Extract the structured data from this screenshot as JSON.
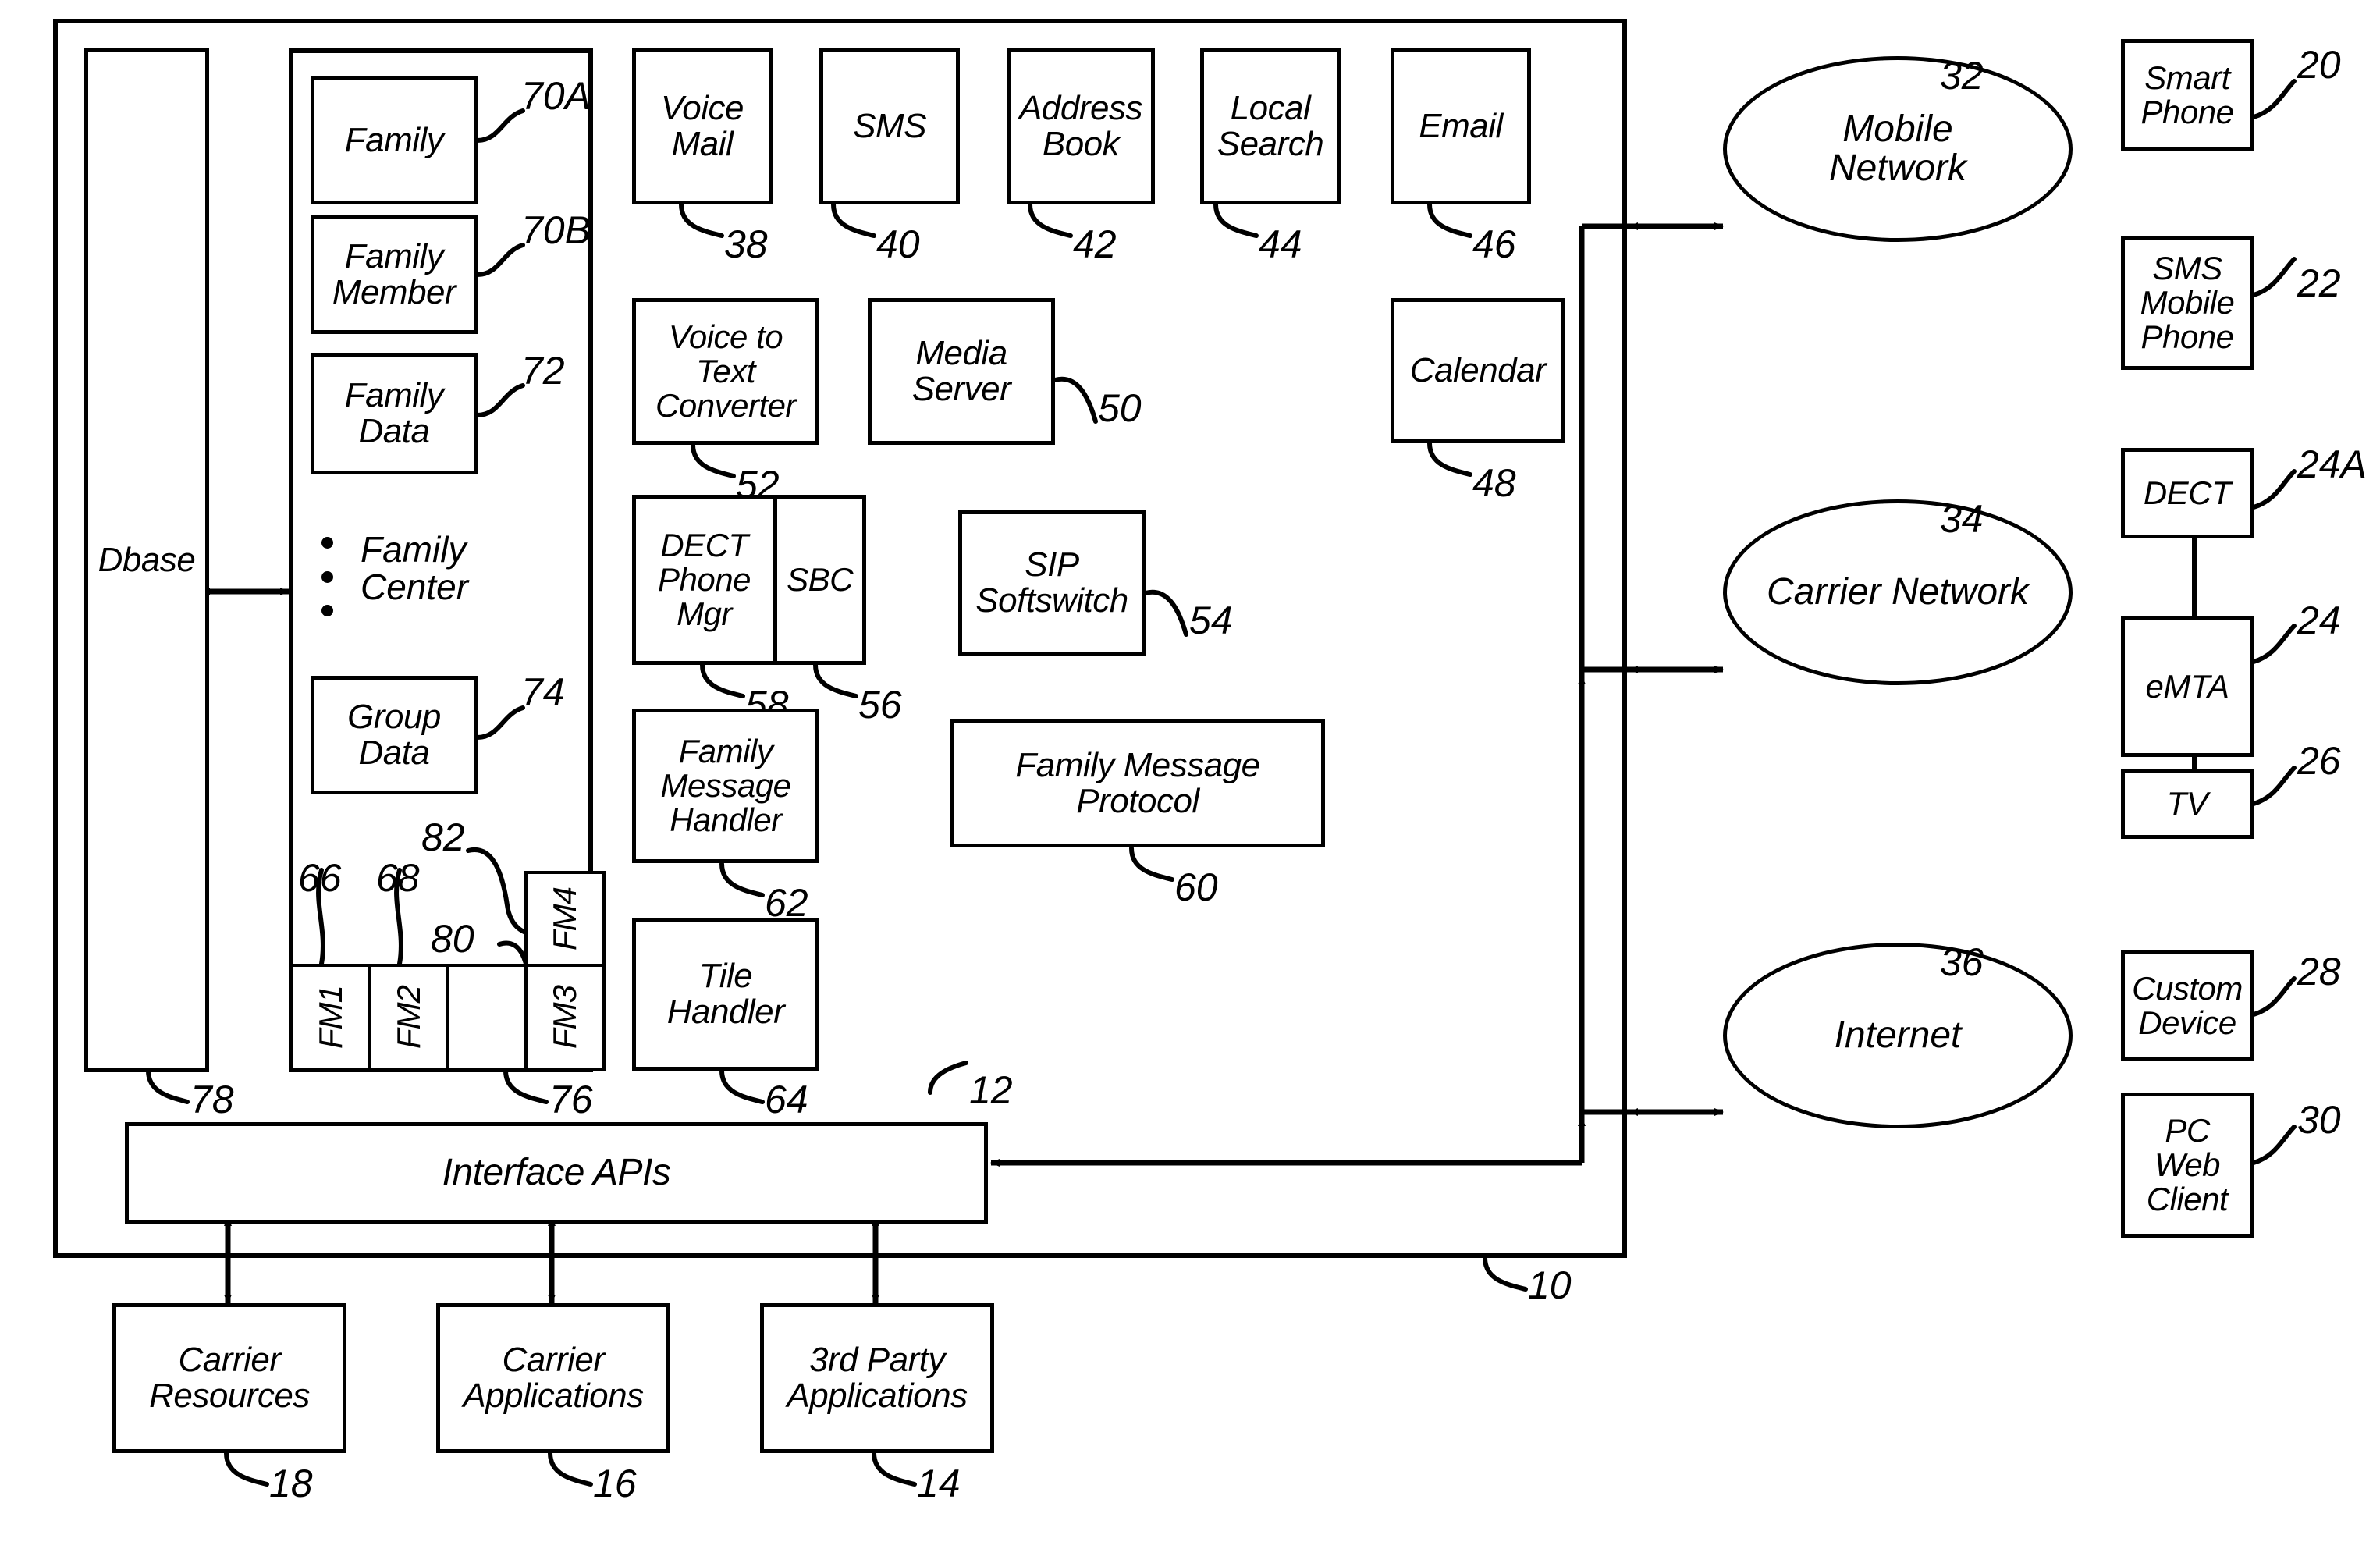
{
  "figure": {
    "type": "patent-block-diagram",
    "outer_system_ref": "10"
  },
  "outer": {
    "ref": "10"
  },
  "dbase": {
    "label": "Dbase",
    "ref": "78"
  },
  "family_center": {
    "ref_family": "70A",
    "ref_family_member": "70B",
    "ref_family_data": "72",
    "ref_group_data": "74",
    "boxes": [
      {
        "label": "Family",
        "ref": "70A"
      },
      {
        "label": "Family\nMember",
        "ref": "70B"
      },
      {
        "label": "Family\nData",
        "ref": "72"
      },
      {
        "label": "Group\nData",
        "ref": "74"
      }
    ],
    "list_label": "Family\nCenter",
    "bullet_count": 3
  },
  "fm_row": {
    "items": [
      {
        "label": "FM1",
        "ref": "66"
      },
      {
        "label": "FM2",
        "ref": "68"
      },
      {
        "label": "FM3",
        "ref": "80"
      },
      {
        "label": "FM4",
        "ref": "82"
      }
    ],
    "group_ref": "76",
    "ref_66": "66",
    "ref_68": "68",
    "ref_80": "80",
    "ref_82": "82",
    "ref_76": "76"
  },
  "apps_row_1": [
    {
      "label": "Voice\nMail",
      "ref": "38"
    },
    {
      "label": "SMS",
      "ref": "40"
    },
    {
      "label": "Address\nBook",
      "ref": "42"
    },
    {
      "label": "Local\nSearch",
      "ref": "44"
    },
    {
      "label": "Email",
      "ref": "46"
    }
  ],
  "apps_row_2": [
    {
      "label": "Voice to\nText\nConverter",
      "ref": "52"
    },
    {
      "label": "Media\nServer",
      "ref": "50"
    },
    {
      "label": "Calendar",
      "ref": "48"
    }
  ],
  "apps_row_3": [
    {
      "label": "DECT\nPhone\nMgr",
      "ref": "58"
    },
    {
      "label": "SBC",
      "ref": "56"
    },
    {
      "label": "SIP\nSoftswitch",
      "ref": "54"
    }
  ],
  "apps_row_4": [
    {
      "label": "Family\nMessage\nHandler",
      "ref": "62"
    },
    {
      "label": "Family Message\nProtocol",
      "ref": "60"
    },
    {
      "label": "Tile\nHandler",
      "ref": "64"
    }
  ],
  "interface_apis": {
    "label": "Interface APIs",
    "ref": "12"
  },
  "bottom_row": [
    {
      "label": "Carrier\nResources",
      "ref": "18"
    },
    {
      "label": "Carrier\nApplications",
      "ref": "16"
    },
    {
      "label": "3rd Party\nApplications",
      "ref": "14"
    }
  ],
  "networks": [
    {
      "label": "Mobile\nNetwork",
      "ref": "32"
    },
    {
      "label": "Carrier Network",
      "ref": "34"
    },
    {
      "label": "Internet",
      "ref": "36"
    }
  ],
  "devices": [
    {
      "label": "Smart\nPhone",
      "ref": "20"
    },
    {
      "label": "SMS\nMobile\nPhone",
      "ref": "22"
    },
    {
      "label": "DECT",
      "ref": "24A"
    },
    {
      "label": "eMTA",
      "ref": "24"
    },
    {
      "label": "TV",
      "ref": "26"
    },
    {
      "label": "Custom\nDevice",
      "ref": "28"
    },
    {
      "label": "PC\nWeb\nClient",
      "ref": "30"
    }
  ],
  "colors": {
    "stroke": "#000000",
    "background": "#ffffff"
  }
}
